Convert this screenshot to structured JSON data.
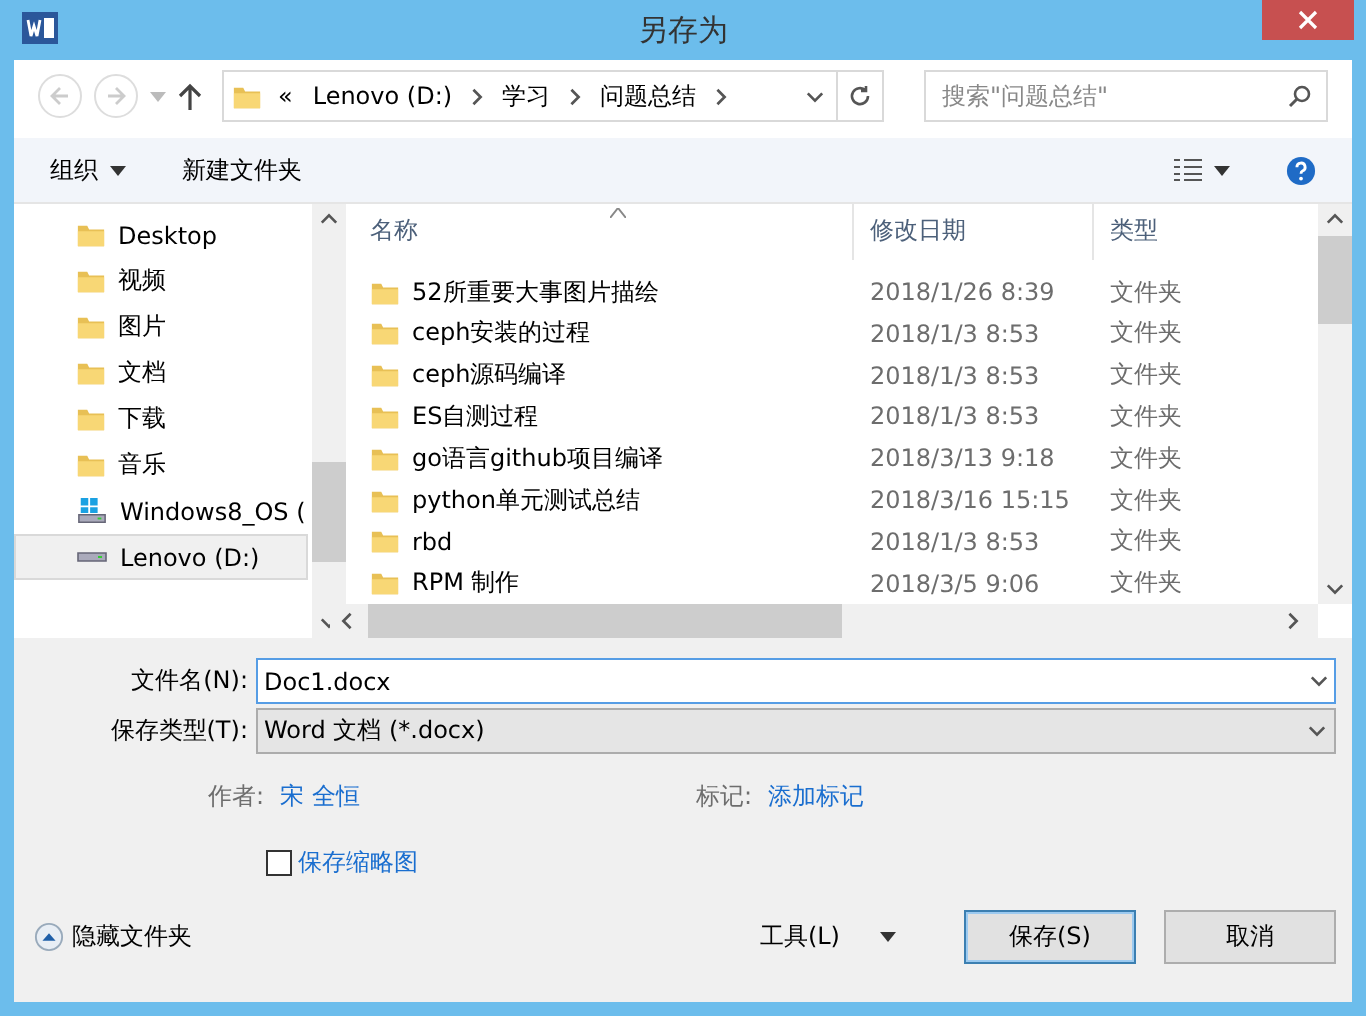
{
  "window": {
    "title": "另存为"
  },
  "nav": {
    "back_disabled": true,
    "forward_disabled": true
  },
  "address": {
    "overflow": "«",
    "segments": [
      "Lenovo (D:)",
      "学习",
      "问题总结"
    ]
  },
  "search": {
    "placeholder": "搜索\"问题总结\""
  },
  "toolbar": {
    "organize": "组织",
    "new_folder": "新建文件夹"
  },
  "sidebar": {
    "items": [
      {
        "label": "Desktop",
        "kind": "folder",
        "selected": false
      },
      {
        "label": "视频",
        "kind": "folder",
        "selected": false
      },
      {
        "label": "图片",
        "kind": "folder",
        "selected": false
      },
      {
        "label": "文档",
        "kind": "folder",
        "selected": false
      },
      {
        "label": "下载",
        "kind": "folder",
        "selected": false
      },
      {
        "label": "音乐",
        "kind": "folder",
        "selected": false
      },
      {
        "label": "Windows8_OS (",
        "kind": "system-drive",
        "selected": false
      },
      {
        "label": "Lenovo (D:)",
        "kind": "drive",
        "selected": true
      }
    ]
  },
  "table": {
    "columns": [
      "名称",
      "修改日期",
      "类型"
    ],
    "rows": [
      {
        "name": "52所重要大事图片描绘",
        "date": "2018/1/26 8:39",
        "type": "文件夹"
      },
      {
        "name": "ceph安装的过程",
        "date": "2018/1/3 8:53",
        "type": "文件夹"
      },
      {
        "name": "ceph源码编译",
        "date": "2018/1/3 8:53",
        "type": "文件夹"
      },
      {
        "name": "ES自测过程",
        "date": "2018/1/3 8:53",
        "type": "文件夹"
      },
      {
        "name": "go语言github项目编译",
        "date": "2018/3/13 9:18",
        "type": "文件夹"
      },
      {
        "name": "python单元测试总结",
        "date": "2018/3/16 15:15",
        "type": "文件夹"
      },
      {
        "name": "rbd",
        "date": "2018/1/3 8:53",
        "type": "文件夹"
      },
      {
        "name": "RPM 制作",
        "date": "2018/3/5 9:06",
        "type": "文件夹"
      }
    ]
  },
  "form": {
    "filename_label": "文件名(N):",
    "filename": "Doc1.docx",
    "filetype_label": "保存类型(T):",
    "filetype": "Word 文档 (*.docx)",
    "author_label": "作者:",
    "author": "宋 全恒",
    "tags_label": "标记:",
    "tags": "添加标记",
    "thumbnail": {
      "label": "保存缩略图",
      "checked": false
    }
  },
  "footer": {
    "hide_folders": "隐藏文件夹",
    "tools": "工具(L)",
    "save": "保存(S)",
    "cancel": "取消"
  }
}
